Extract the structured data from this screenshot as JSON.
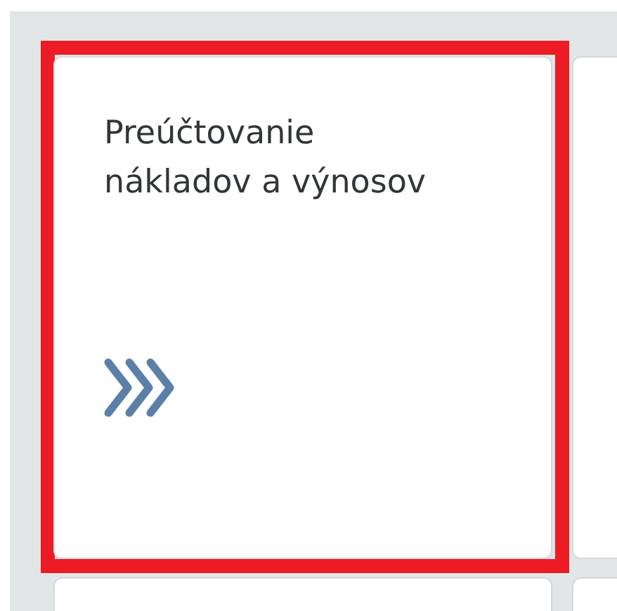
{
  "tiles": [
    {
      "title": "Preúčtovanie nákladov a výnosov",
      "highlighted": true
    }
  ]
}
